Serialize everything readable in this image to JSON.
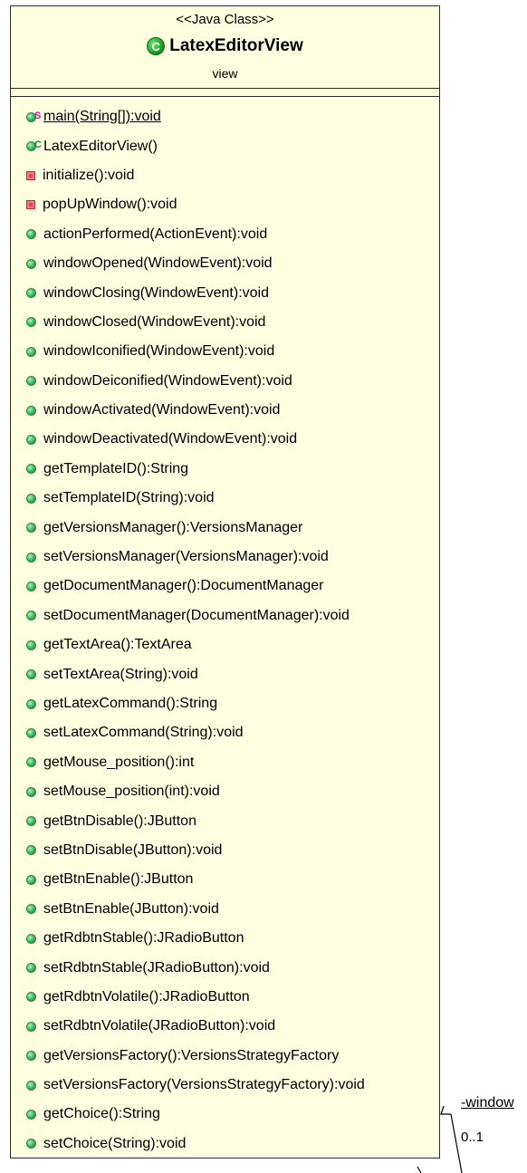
{
  "class": {
    "stereotype": "<<Java Class>>",
    "name": "LatexEditorView",
    "package": "view",
    "icon": "class-icon",
    "icon_letter": "C"
  },
  "methods": [
    {
      "sig": "main(String[]):void",
      "vis": "public",
      "mod": "S",
      "underline": true
    },
    {
      "sig": "LatexEditorView()",
      "vis": "public",
      "mod": "C",
      "underline": false
    },
    {
      "sig": "initialize():void",
      "vis": "private",
      "mod": "",
      "underline": false
    },
    {
      "sig": "popUpWindow():void",
      "vis": "private",
      "mod": "",
      "underline": false
    },
    {
      "sig": "actionPerformed(ActionEvent):void",
      "vis": "public",
      "mod": "",
      "underline": false
    },
    {
      "sig": "windowOpened(WindowEvent):void",
      "vis": "public",
      "mod": "",
      "underline": false
    },
    {
      "sig": "windowClosing(WindowEvent):void",
      "vis": "public",
      "mod": "",
      "underline": false
    },
    {
      "sig": "windowClosed(WindowEvent):void",
      "vis": "public",
      "mod": "",
      "underline": false
    },
    {
      "sig": "windowIconified(WindowEvent):void",
      "vis": "public",
      "mod": "",
      "underline": false
    },
    {
      "sig": "windowDeiconified(WindowEvent):void",
      "vis": "public",
      "mod": "",
      "underline": false
    },
    {
      "sig": "windowActivated(WindowEvent):void",
      "vis": "public",
      "mod": "",
      "underline": false
    },
    {
      "sig": "windowDeactivated(WindowEvent):void",
      "vis": "public",
      "mod": "",
      "underline": false
    },
    {
      "sig": "getTemplateID():String",
      "vis": "public",
      "mod": "",
      "underline": false
    },
    {
      "sig": "setTemplateID(String):void",
      "vis": "public",
      "mod": "",
      "underline": false
    },
    {
      "sig": "getVersionsManager():VersionsManager",
      "vis": "public",
      "mod": "",
      "underline": false
    },
    {
      "sig": "setVersionsManager(VersionsManager):void",
      "vis": "public",
      "mod": "",
      "underline": false
    },
    {
      "sig": "getDocumentManager():DocumentManager",
      "vis": "public",
      "mod": "",
      "underline": false
    },
    {
      "sig": "setDocumentManager(DocumentManager):void",
      "vis": "public",
      "mod": "",
      "underline": false
    },
    {
      "sig": "getTextArea():TextArea",
      "vis": "public",
      "mod": "",
      "underline": false
    },
    {
      "sig": "setTextArea(String):void",
      "vis": "public",
      "mod": "",
      "underline": false
    },
    {
      "sig": "getLatexCommand():String",
      "vis": "public",
      "mod": "",
      "underline": false
    },
    {
      "sig": "setLatexCommand(String):void",
      "vis": "public",
      "mod": "",
      "underline": false
    },
    {
      "sig": "getMouse_position():int",
      "vis": "public",
      "mod": "",
      "underline": false
    },
    {
      "sig": "setMouse_position(int):void",
      "vis": "public",
      "mod": "",
      "underline": false
    },
    {
      "sig": "getBtnDisable():JButton",
      "vis": "public",
      "mod": "",
      "underline": false
    },
    {
      "sig": "setBtnDisable(JButton):void",
      "vis": "public",
      "mod": "",
      "underline": false
    },
    {
      "sig": "getBtnEnable():JButton",
      "vis": "public",
      "mod": "",
      "underline": false
    },
    {
      "sig": "setBtnEnable(JButton):void",
      "vis": "public",
      "mod": "",
      "underline": false
    },
    {
      "sig": "getRdbtnStable():JRadioButton",
      "vis": "public",
      "mod": "",
      "underline": false
    },
    {
      "sig": "setRdbtnStable(JRadioButton):void",
      "vis": "public",
      "mod": "",
      "underline": false
    },
    {
      "sig": "getRdbtnVolatile():JRadioButton",
      "vis": "public",
      "mod": "",
      "underline": false
    },
    {
      "sig": "setRdbtnVolatile(JRadioButton):void",
      "vis": "public",
      "mod": "",
      "underline": false
    },
    {
      "sig": "getVersionsFactory():VersionsStrategyFactory",
      "vis": "public",
      "mod": "",
      "underline": false
    },
    {
      "sig": "setVersionsFactory(VersionsStrategyFactory):void",
      "vis": "public",
      "mod": "",
      "underline": false
    },
    {
      "sig": "getChoice():String",
      "vis": "public",
      "mod": "",
      "underline": false
    },
    {
      "sig": "setChoice(String):void",
      "vis": "public",
      "mod": "",
      "underline": false
    }
  ],
  "association": {
    "role": "-window",
    "multiplicity": "0..1"
  },
  "colors": {
    "class_fill": "#fefee0",
    "border": "#2b2b2b",
    "public_icon": "#35b354",
    "private_icon": "#d94456",
    "static_mark": "#d01891",
    "constructor_mark": "#118a35"
  }
}
